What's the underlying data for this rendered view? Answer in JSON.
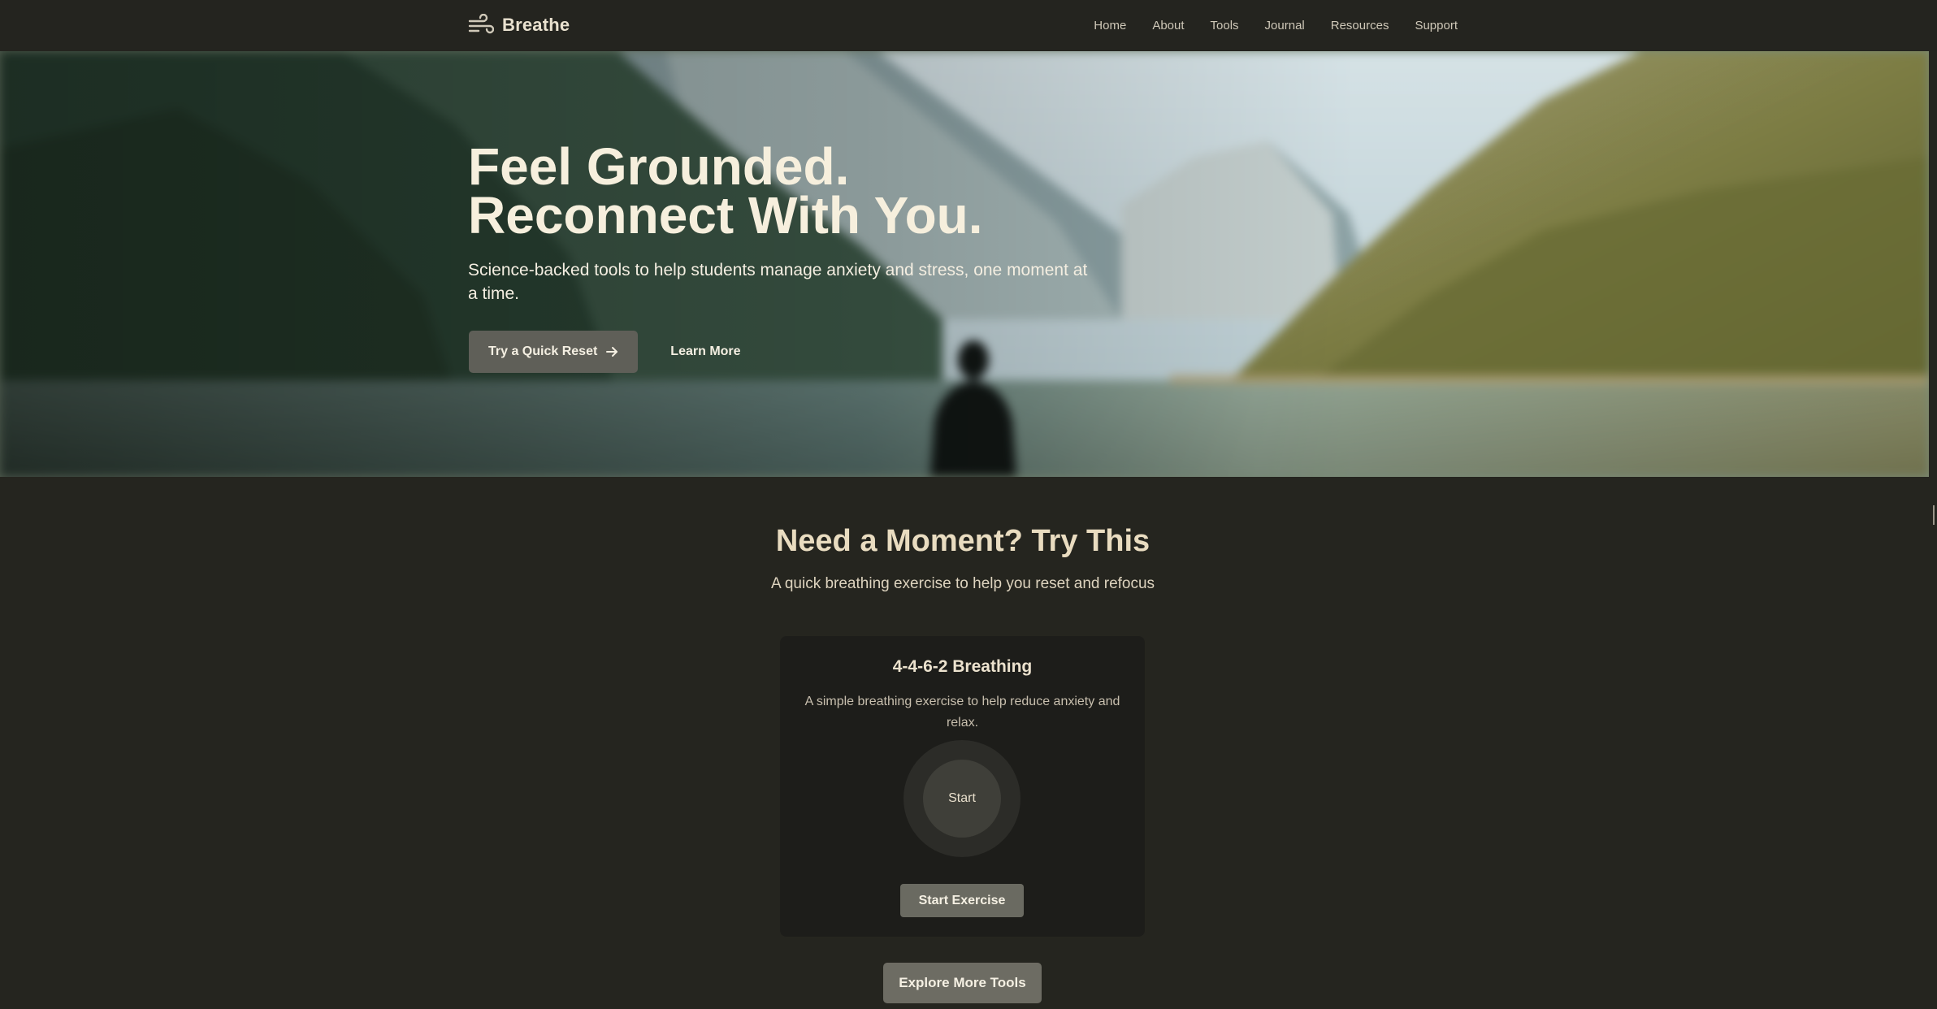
{
  "brand": {
    "name": "Breathe",
    "icon": "wind-icon"
  },
  "nav": {
    "links": [
      "Home",
      "About",
      "Tools",
      "Journal",
      "Resources",
      "Support"
    ]
  },
  "hero": {
    "title_line1": "Feel Grounded.",
    "title_line2": "Reconnect With You.",
    "subtitle": "Science-backed tools to help students manage anxiety and stress, one moment at a time.",
    "primary_cta": "Try a Quick Reset",
    "primary_cta_icon": "arrow-right-icon",
    "secondary_cta": "Learn More"
  },
  "section": {
    "title": "Need a Moment? Try This",
    "subtitle": "A quick breathing exercise to help you reset and refocus"
  },
  "exercise_card": {
    "title": "4-4-6-2 Breathing",
    "description": "A simple breathing exercise to help reduce anxiety and relax.",
    "circle_label": "Start",
    "button_label": "Start Exercise"
  },
  "explore_button": "Explore More Tools",
  "colors": {
    "background": "#25251f",
    "card": "#1d1d1a",
    "heading": "#e9dcc0",
    "button": "#5f5f58"
  }
}
